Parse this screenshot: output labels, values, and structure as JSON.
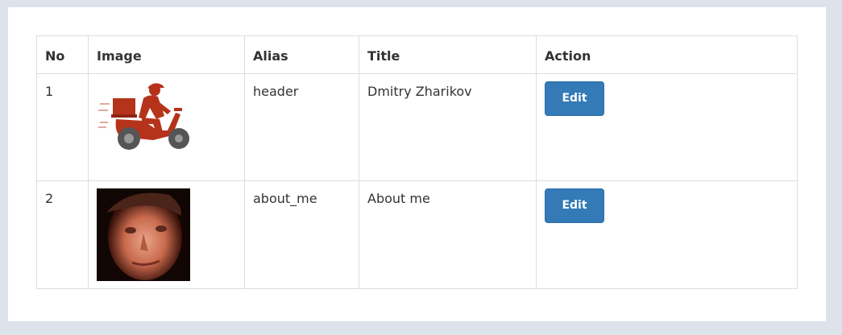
{
  "table": {
    "headers": {
      "no": "No",
      "image": "Image",
      "alias": "Alias",
      "title": "Title",
      "action": "Action"
    },
    "rows": [
      {
        "no": "1",
        "image": "delivery-scooter-image",
        "alias": "header",
        "title": "Dmitry Zharikov",
        "action": "Edit"
      },
      {
        "no": "2",
        "image": "portrait-photo-image",
        "alias": "about_me",
        "title": "About me",
        "action": "Edit"
      }
    ]
  },
  "colors": {
    "page_background": "#dce3ea",
    "panel_background": "#ffffff",
    "border": "#dddddd",
    "button_primary": "#337ab7",
    "scooter_red": "#b5331a"
  }
}
